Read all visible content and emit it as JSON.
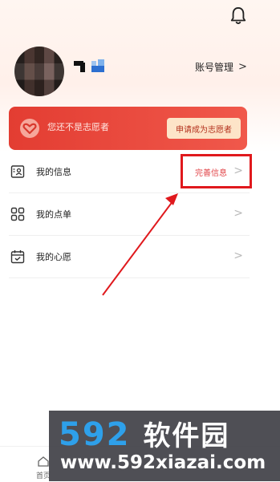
{
  "header": {
    "bell_icon": "bell-icon",
    "account_management": "账号管理"
  },
  "volunteer": {
    "status_text": "您还不是志愿者",
    "apply_button": "申请成为志愿者",
    "colors": {
      "banner": "#e8463a",
      "button_bg": "#fde4c8",
      "button_text": "#b4321e"
    }
  },
  "menu": {
    "items": [
      {
        "label": "我的信息",
        "icon": "id-card-icon",
        "extra": "完善信息"
      },
      {
        "label": "我的点单",
        "icon": "grid-icon"
      },
      {
        "label": "我的心愿",
        "icon": "calendar-icon"
      }
    ]
  },
  "bottom_nav": {
    "home_label": "首页"
  },
  "watermark": {
    "logo_digits": "592",
    "logo_text": "软件园",
    "url": "www.592xiazai.com"
  }
}
